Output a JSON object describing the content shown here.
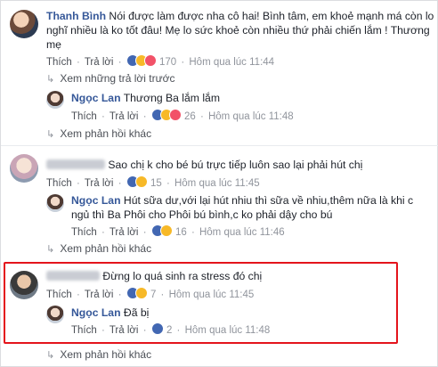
{
  "actions": {
    "like": "Thích",
    "reply": "Trả lời",
    "sep": "·"
  },
  "thread1": {
    "author": "Thanh Bình",
    "text_line1": "Nói được làm được nha cô hai! Bình tâm, em khoẻ mạnh má còn lo",
    "text_line2": "nghĩ nhiều là ko tốt đâu! Mẹ lo sức khoẻ còn nhiều thứ phải chiến lắm ! Thương",
    "text_line3": "mẹ",
    "reaction_count": "170",
    "time": "Hôm qua lúc 11:44",
    "view_previous": "Xem những trả lời trước",
    "reply": {
      "author": "Ngọc Lan",
      "text": "Thương Ba lắm lắm",
      "reaction_count": "26",
      "time": "Hôm qua lúc 11:48"
    },
    "view_more": "Xem phản hồi khác"
  },
  "thread2": {
    "text": "Sao chị k cho bé bú trực tiếp luôn sao lại phải hút chị",
    "reaction_count": "15",
    "time": "Hôm qua lúc 11:45",
    "reply": {
      "author": "Ngọc Lan",
      "text_line1": "Hút sữa dư,với lại hút nhiu thì sữa về nhiu,thêm nữa là khi c",
      "text_line2": "ngủ thì Ba Phôi cho Phôi bú bình,c ko phải dậy cho bú",
      "reaction_count": "16",
      "time": "Hôm qua lúc 11:46"
    },
    "view_more": "Xem phản hồi khác"
  },
  "thread3": {
    "text": "Đừng lo quá sinh ra stress đó chị",
    "reaction_count": "7",
    "time": "Hôm qua lúc 11:45",
    "reply": {
      "author": "Ngọc Lan",
      "text": "Đã bị",
      "reaction_count": "2",
      "time": "Hôm qua lúc 11:48"
    },
    "view_more": "Xem phản hồi khác"
  },
  "colors": {
    "link": "#365899",
    "meta": "#90949c",
    "highlight": "#e4141c"
  }
}
